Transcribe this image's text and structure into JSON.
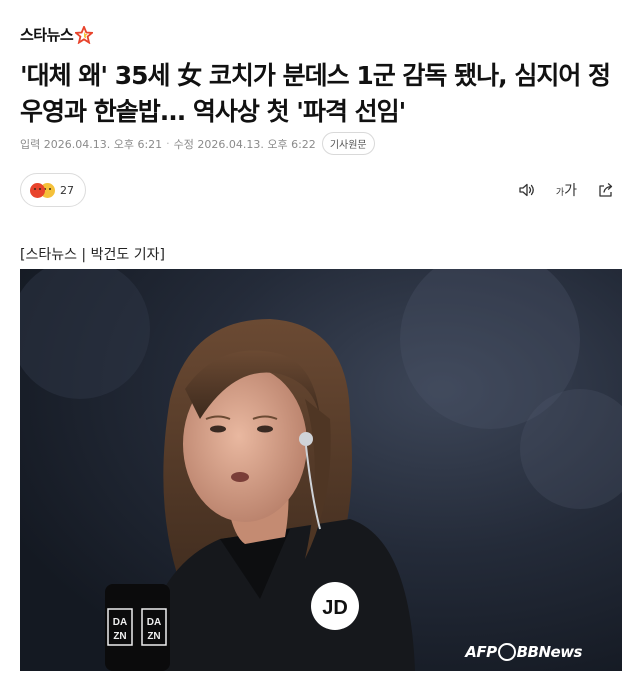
{
  "header": {
    "brand": "스타뉴스"
  },
  "article": {
    "title": "'대체 왜' 35세 女 코치가 분데스 1군 감독 됐나, 심지어 정우영과 한솥밥... 역사상 첫 '파격 선임'",
    "published": "입력 2026.04.13. 오후 6:21",
    "modified": "수정 2026.04.13. 오후 6:22",
    "original_link": "기사원문",
    "reaction_count": "27",
    "font_size_small": "가",
    "font_size_big": "가",
    "credit": "[스타뉴스 | 박건도 기자]",
    "photo_watermark": {
      "left": "AFP",
      "right": "BBNews"
    },
    "photo_mic_text": [
      "DA",
      "ZN"
    ],
    "photo_jacket_logo": "JD"
  },
  "colors": {
    "brand_star": "#e8442c",
    "brand_star_accent": "#f5c13a",
    "meta_text": "#8b8b8b"
  },
  "icons": [
    "star-logo-icon",
    "angry-emoji-icon",
    "smile-emoji-icon",
    "speaker-icon",
    "font-size-icon",
    "share-icon"
  ]
}
